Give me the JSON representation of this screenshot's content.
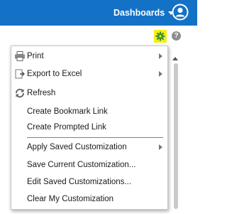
{
  "header": {
    "dashboards_label": "Dashboards",
    "user_icon": "user-circle-icon",
    "background_color": "#1472c6"
  },
  "toolbar": {
    "gear_icon": "gear-icon",
    "gear_highlight": "#f4ef18",
    "help_icon": "help-icon",
    "help_label": "?"
  },
  "menu": {
    "items": [
      {
        "label": "Print",
        "icon": "printer-icon",
        "submenu": true
      },
      {
        "label": "Export to Excel",
        "icon": "export-icon",
        "submenu": true
      },
      {
        "label": "Refresh",
        "icon": "refresh-icon",
        "submenu": false
      },
      {
        "label": "Create Bookmark Link",
        "icon": "",
        "submenu": false
      },
      {
        "label": "Create Prompted Link",
        "icon": "",
        "submenu": false
      },
      {
        "label": "Apply Saved Customization",
        "icon": "",
        "submenu": true
      },
      {
        "label": "Save Current Customization...",
        "icon": "",
        "submenu": false
      },
      {
        "label": "Edit Saved Customizations...",
        "icon": "",
        "submenu": false
      },
      {
        "label": "Clear My Customization",
        "icon": "",
        "submenu": false
      }
    ]
  }
}
